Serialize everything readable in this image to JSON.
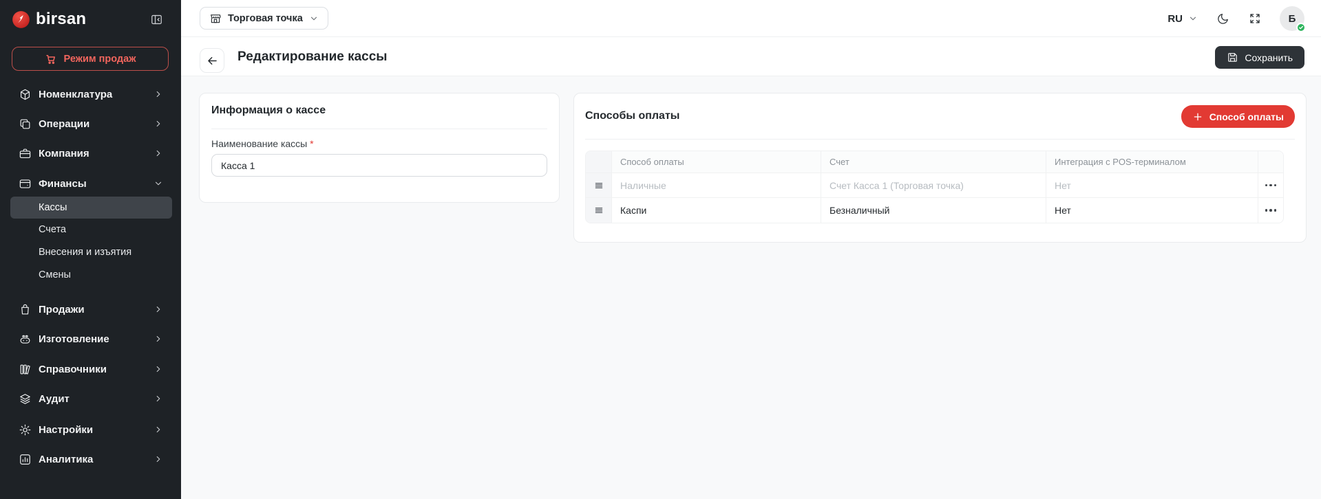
{
  "app": {
    "logo_text": "birsan"
  },
  "sidebar": {
    "sales_mode_button": "Режим продаж",
    "items": [
      {
        "label": "Номенклатура",
        "icon": "cube-icon"
      },
      {
        "label": "Операции",
        "icon": "copy-icon"
      },
      {
        "label": "Компания",
        "icon": "briefcase-icon"
      },
      {
        "label": "Финансы",
        "icon": "wallet-icon",
        "expanded": true
      },
      {
        "label": "Продажи",
        "icon": "shopping-bag-icon"
      },
      {
        "label": "Изготовление",
        "icon": "robot-icon"
      },
      {
        "label": "Справочники",
        "icon": "books-icon"
      },
      {
        "label": "Аудит",
        "icon": "layers-icon"
      },
      {
        "label": "Настройки",
        "icon": "gear-icon"
      },
      {
        "label": "Аналитика",
        "icon": "bar-chart-icon"
      }
    ],
    "finance_children": [
      {
        "label": "Кассы",
        "active": true
      },
      {
        "label": "Счета",
        "active": false
      },
      {
        "label": "Внесения и изъятия",
        "active": false
      },
      {
        "label": "Смены",
        "active": false
      }
    ]
  },
  "topbar": {
    "store_selector": "Торговая точка",
    "language": "RU",
    "avatar_initial": "Б"
  },
  "header": {
    "title": "Редактирование кассы",
    "save_button": "Сохранить"
  },
  "info_card": {
    "title": "Информация о кассе",
    "field_label": "Наименование кассы",
    "required_mark": "*",
    "field_value": "Касса 1"
  },
  "payments_card": {
    "title": "Способы оплаты",
    "add_button": "Способ оплаты",
    "table": {
      "columns": [
        "Способ оплаты",
        "Счет",
        "Интеграция с POS-терминалом"
      ],
      "rows": [
        {
          "method": "Наличные",
          "account": "Счет Касса 1 (Торговая точка)",
          "integration": "Нет",
          "disabled": true
        },
        {
          "method": "Каспи",
          "account": "Безналичный",
          "integration": "Нет",
          "disabled": false
        }
      ]
    }
  },
  "colors": {
    "accent_red": "#e23a33",
    "sidebar_bg": "#1e2226",
    "save_button_bg": "#2e3338",
    "badge_green": "#2db55d"
  }
}
